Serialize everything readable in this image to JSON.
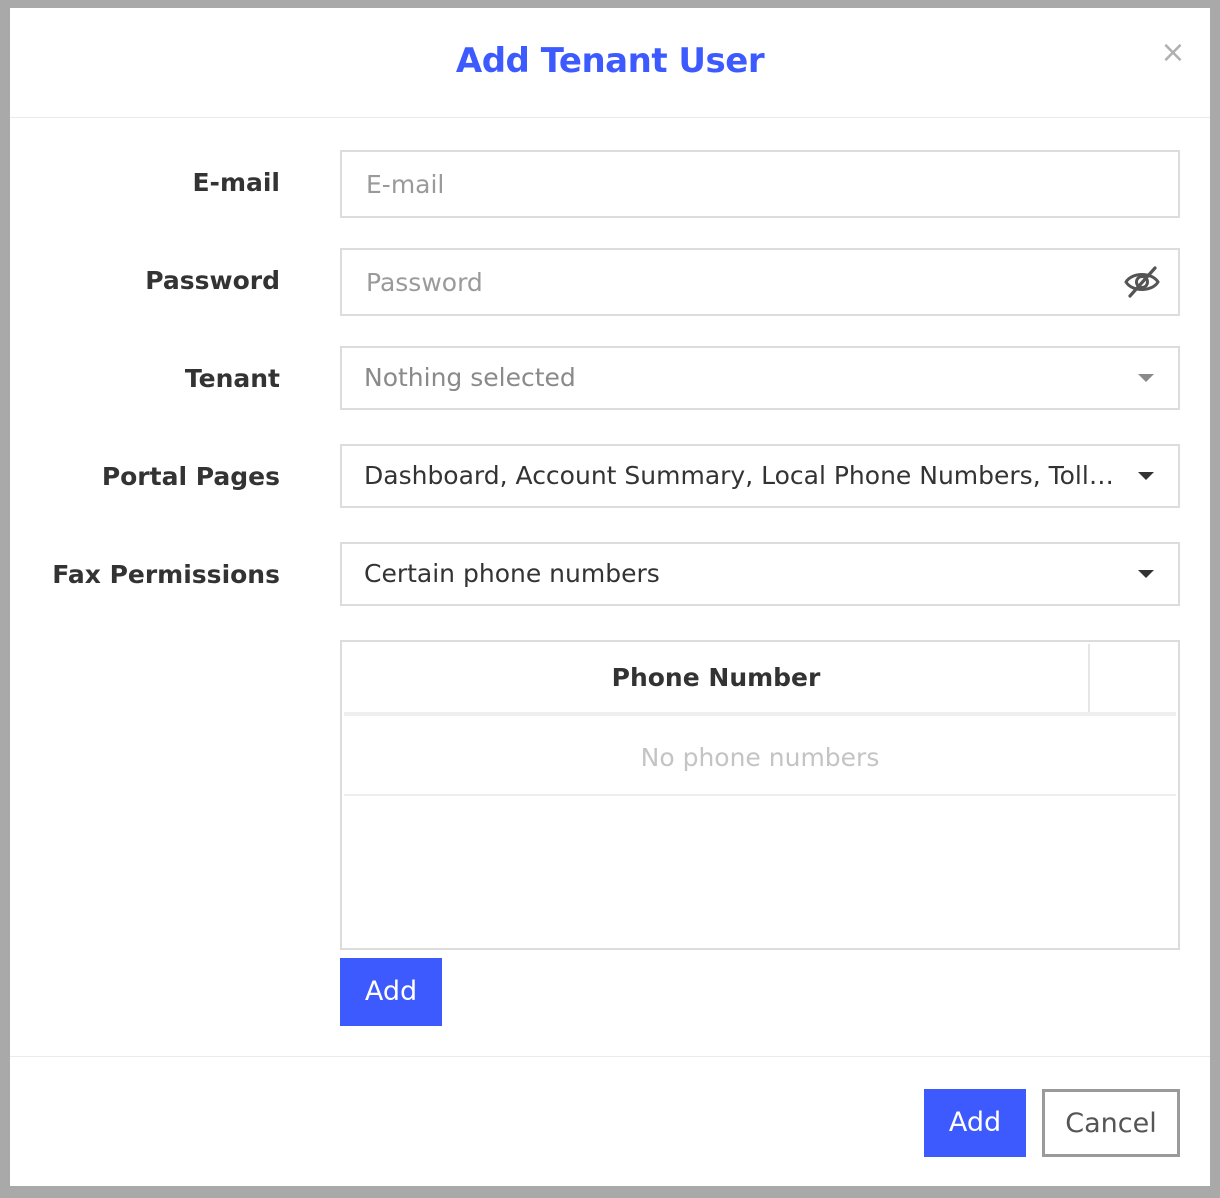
{
  "modal": {
    "title": "Add Tenant User",
    "close_symbol": "×"
  },
  "form": {
    "email": {
      "label": "E-mail",
      "placeholder": "E-mail",
      "value": ""
    },
    "password": {
      "label": "Password",
      "placeholder": "Password",
      "value": "",
      "toggle_icon": "eye-slash-icon"
    },
    "tenant": {
      "label": "Tenant",
      "selected": "Nothing selected"
    },
    "portal_pages": {
      "label": "Portal Pages",
      "selected": "Dashboard, Account Summary, Local Phone Numbers, Toll ..."
    },
    "fax_permissions": {
      "label": "Fax Permissions",
      "selected": "Certain phone numbers"
    }
  },
  "phone_table": {
    "column_header": "Phone Number",
    "empty_text": "No phone numbers",
    "add_label": "Add"
  },
  "footer": {
    "add_label": "Add",
    "cancel_label": "Cancel"
  },
  "colors": {
    "accent": "#3d5afe",
    "border": "#dcdcdc",
    "backdrop": "#a9a9a9"
  }
}
